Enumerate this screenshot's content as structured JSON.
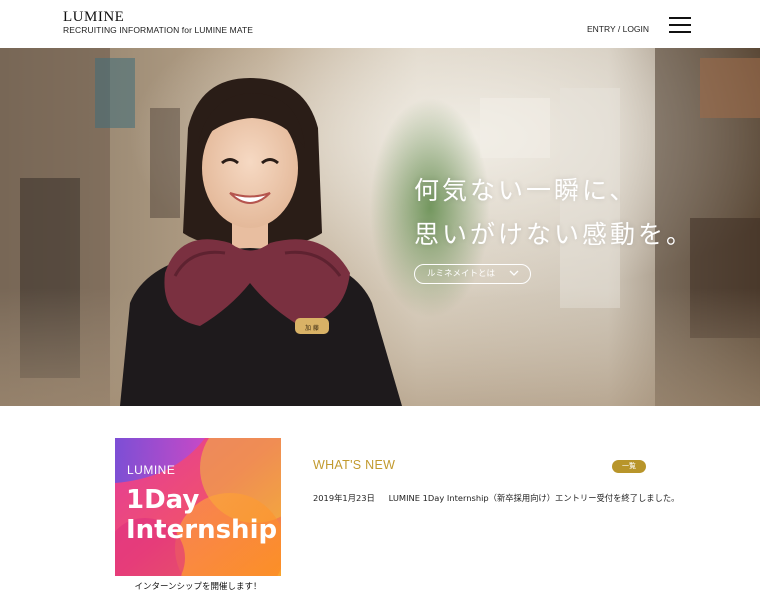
{
  "header": {
    "logo": "LUMINE",
    "subtitle": "RECRUITING INFORMATION for LUMINE MATE",
    "entry_login": "ENTRY / LOGIN",
    "menu_icon": "hamburger-menu-icon"
  },
  "hero": {
    "copy_line1": "何気ない一瞬に、",
    "copy_line2": "思いがけない感動を。",
    "button_label": "ルミネメイトとは",
    "button_icon": "chevron-down-icon",
    "name_tag": "加 藤"
  },
  "banner": {
    "brand": "LUMINE",
    "line1": "1Day",
    "line2": "Internship",
    "caption": "インターンシップを開催します！"
  },
  "news": {
    "heading": "WHAT'S NEW",
    "more_label": "一覧",
    "items": [
      {
        "date": "2019年1月23日",
        "text": "LUMINE 1Day Internship（新卒採用向け）エントリー受付を終了しました。"
      }
    ]
  },
  "colors": {
    "accent_gold": "#c29a2e",
    "badge_gold": "#b8952a",
    "banner_magenta": "#e8338a",
    "banner_orange": "#f5a623",
    "banner_purple": "#7b4fd6"
  }
}
